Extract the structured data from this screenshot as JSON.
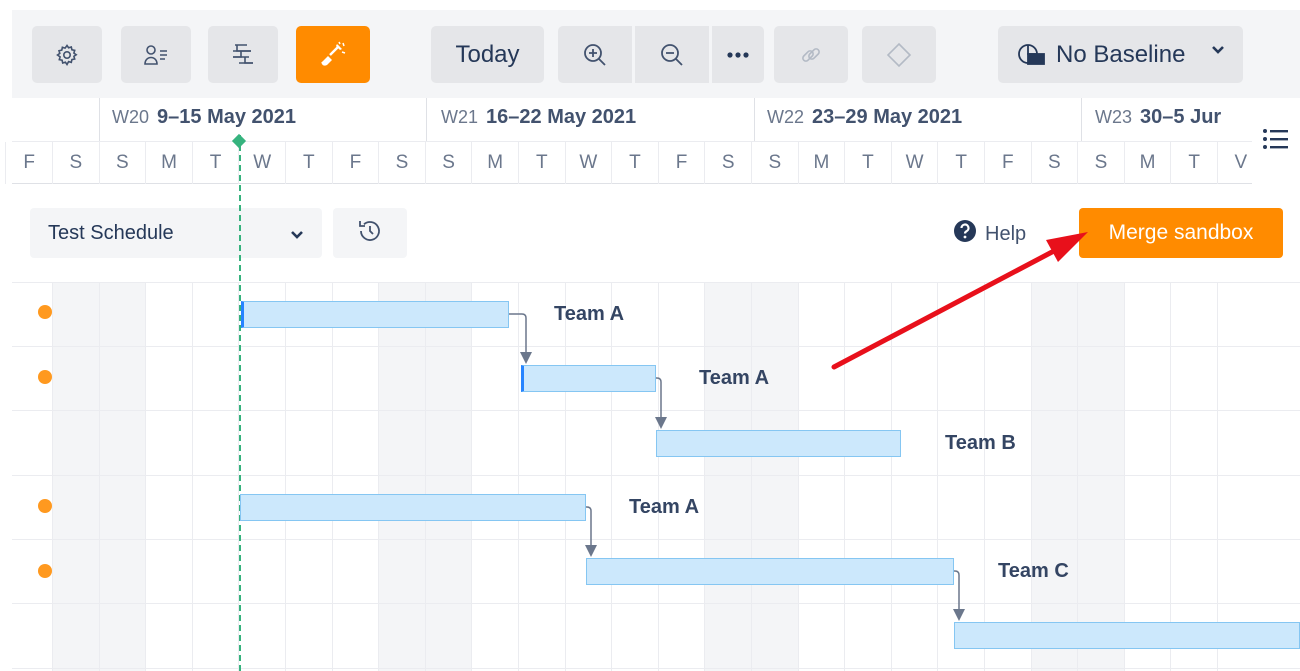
{
  "toolbar": {
    "today_label": "Today",
    "baseline_label": "No Baseline",
    "icons": [
      "gear-icon",
      "resource-list-icon",
      "wbs-icon",
      "sandbox-shovel-icon",
      "zoom-in-icon",
      "zoom-out-icon",
      "more-icon",
      "link-icon",
      "milestone-diamond-icon",
      "baseline-icon",
      "chevron-down-icon"
    ],
    "accent_color": "#ff8b00"
  },
  "timeline": {
    "weeks": [
      {
        "num": "W20",
        "dates": "9–15 May 2021"
      },
      {
        "num": "W21",
        "dates": "16–22 May 2021"
      },
      {
        "num": "W22",
        "dates": "23–29 May 2021"
      },
      {
        "num": "W23",
        "dates": "30–5 Jur"
      }
    ],
    "days": [
      "F",
      "S",
      "S",
      "M",
      "T",
      "W",
      "T",
      "F",
      "S",
      "S",
      "M",
      "T",
      "W",
      "T",
      "F",
      "S",
      "S",
      "M",
      "T",
      "W",
      "T",
      "F",
      "S",
      "S",
      "M",
      "T",
      "V"
    ]
  },
  "schedule": {
    "selected": "Test Schedule",
    "help_label": "Help",
    "merge_label": "Merge sandbox"
  },
  "tasks": [
    {
      "label": "Team A",
      "unsaved_dot": true
    },
    {
      "label": "Team A",
      "unsaved_dot": true
    },
    {
      "label": "Team B",
      "unsaved_dot": false
    },
    {
      "label": "Team A",
      "unsaved_dot": true
    },
    {
      "label": "Team C",
      "unsaved_dot": true
    },
    {
      "label": "",
      "unsaved_dot": false
    }
  ]
}
